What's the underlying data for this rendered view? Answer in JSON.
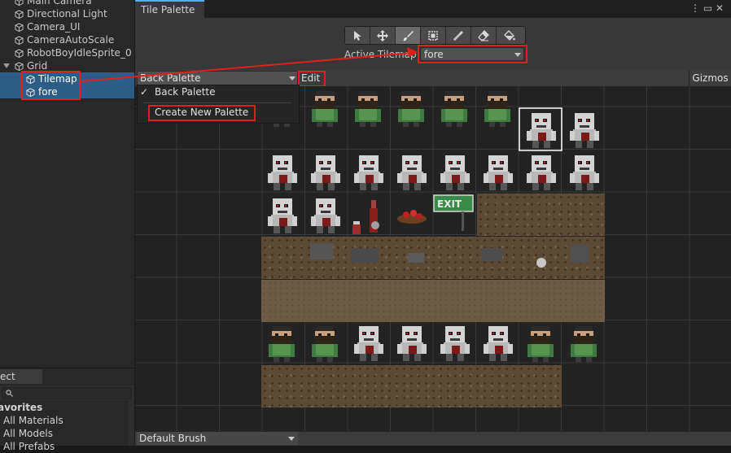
{
  "hierarchy": {
    "items": [
      {
        "label": "Main Camera"
      },
      {
        "label": "Directional Light"
      },
      {
        "label": "Camera_UI"
      },
      {
        "label": "CameraAutoScale"
      },
      {
        "label": "RobotBoyIdleSprite_0"
      },
      {
        "label": "Grid"
      },
      {
        "label": "Tilemap"
      },
      {
        "label": "fore"
      }
    ]
  },
  "project": {
    "tab_label": "ect",
    "search_icon": "search-icon",
    "favorites_header": "avorites",
    "items": [
      {
        "label": "All Materials"
      },
      {
        "label": "All Models"
      },
      {
        "label": "All Prefabs"
      }
    ]
  },
  "tile_palette": {
    "tab_label": "Tile Palette",
    "window_icons": "⋮ ▭ ✕",
    "tools": [
      {
        "name": "select-icon"
      },
      {
        "name": "move-icon"
      },
      {
        "name": "paint-brush-icon"
      },
      {
        "name": "box-fill-icon"
      },
      {
        "name": "picker-icon"
      },
      {
        "name": "eraser-icon"
      },
      {
        "name": "flood-fill-icon"
      }
    ],
    "active_tool": "paint-brush-icon",
    "active_tilemap_label": "Active Tilemap",
    "active_tilemap_value": "fore",
    "palette_value": "Back Palette",
    "edit_label": "Edit",
    "gizmos_label": "Gizmos",
    "palette_menu": {
      "checked_mark": "✓",
      "items": [
        "Back Palette",
        "Create New Palette"
      ]
    },
    "brush_value": "Default Brush"
  },
  "colors": {
    "selection": "#2c5d87",
    "highlight": "#e01f1f",
    "accent_tab": "#58a9ff"
  }
}
